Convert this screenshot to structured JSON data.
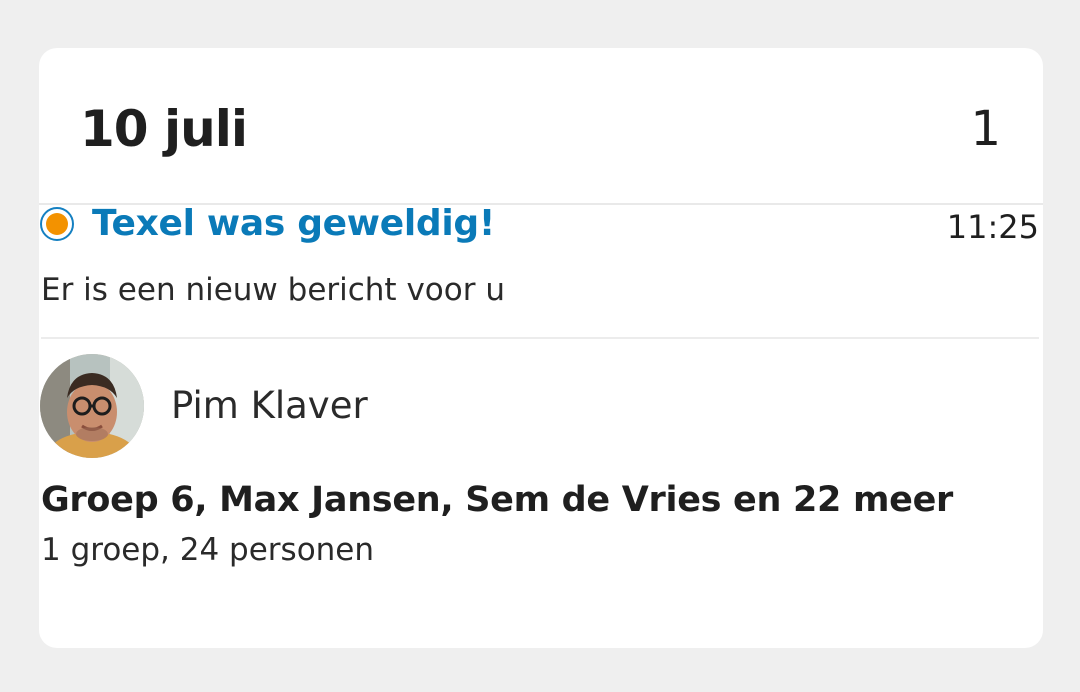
{
  "day_header": {
    "date": "10 juli",
    "count": "1"
  },
  "message": {
    "status": "unread",
    "status_colors": {
      "ring": "#1580c1",
      "fill": "#f39200"
    },
    "title": "Texel was geweldig!",
    "time": "11:25",
    "preview": "Er is een nieuw bericht voor u",
    "sender": {
      "name": "Pim Klaver",
      "avatar": "avatar-photo"
    },
    "recipients": "Groep 6, Max Jansen, Sem de Vries en 22 meer",
    "recipients_summary": "1 groep, 24 personen"
  },
  "colors": {
    "accent": "#0a7ab8",
    "background": "#efefef",
    "card": "#ffffff"
  }
}
